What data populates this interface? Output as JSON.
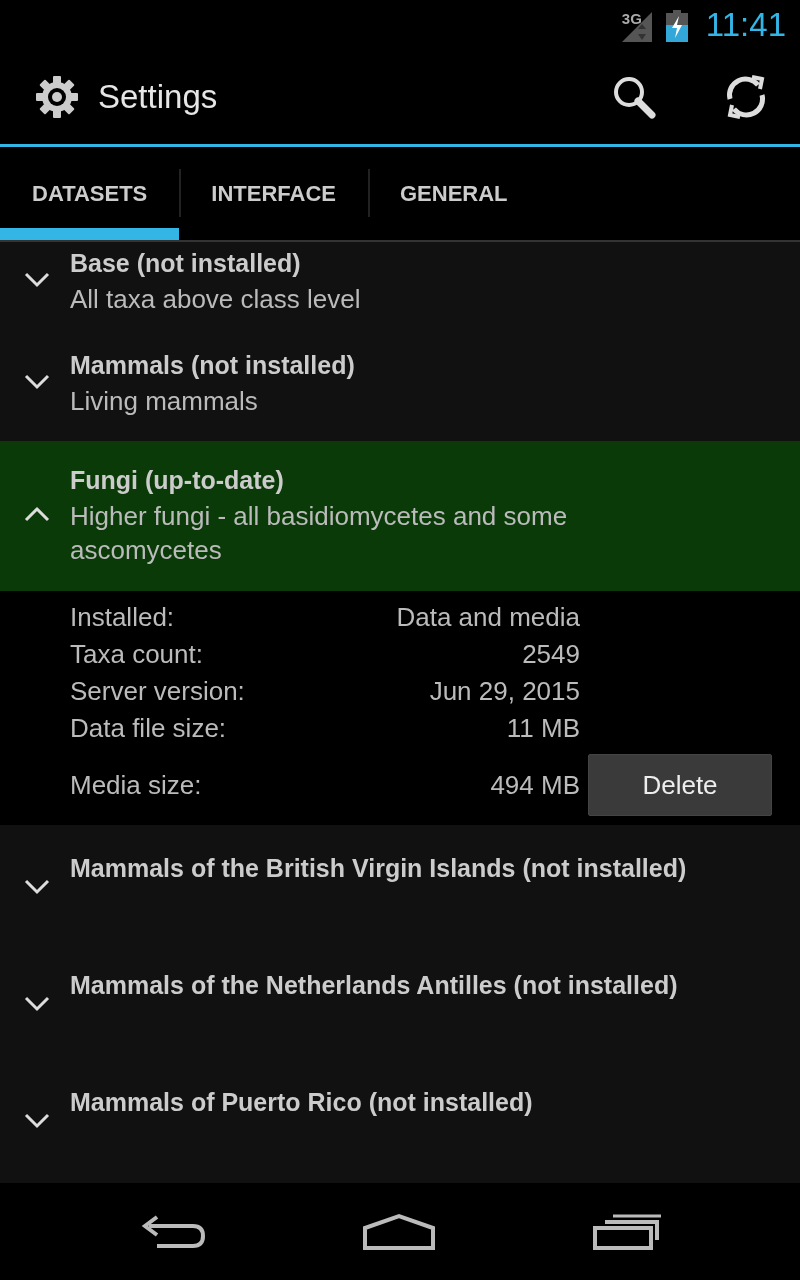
{
  "status_bar": {
    "network": "3G",
    "time": "11:41"
  },
  "action_bar": {
    "title": "Settings"
  },
  "tabs": [
    {
      "label": "DATASETS",
      "selected": true
    },
    {
      "label": "INTERFACE",
      "selected": false
    },
    {
      "label": "GENERAL",
      "selected": false
    }
  ],
  "datasets": [
    {
      "title": "Base (not installed)",
      "subtitle": "All taxa above class level",
      "expanded": false
    },
    {
      "title": "Mammals (not installed)",
      "subtitle": "Living mammals",
      "expanded": false
    },
    {
      "title": "Fungi (up-to-date)",
      "subtitle": "Higher fungi - all basidiomycetes and some ascomycetes",
      "expanded": true,
      "details": [
        {
          "label": "Installed:",
          "value": "Data and media"
        },
        {
          "label": "Taxa count:",
          "value": "2549"
        },
        {
          "label": "Server version:",
          "value": "Jun 29, 2015"
        },
        {
          "label": "Data file size:",
          "value": "11 MB"
        },
        {
          "label": "Media size:",
          "value": "494 MB"
        }
      ],
      "button": "Delete"
    },
    {
      "title": "Mammals of the British Virgin Islands (not installed)",
      "expanded": false
    },
    {
      "title": "Mammals of the Netherlands Antilles (not installed)",
      "expanded": false
    },
    {
      "title": "Mammals of Puerto Rico (not installed)",
      "expanded": false
    }
  ]
}
